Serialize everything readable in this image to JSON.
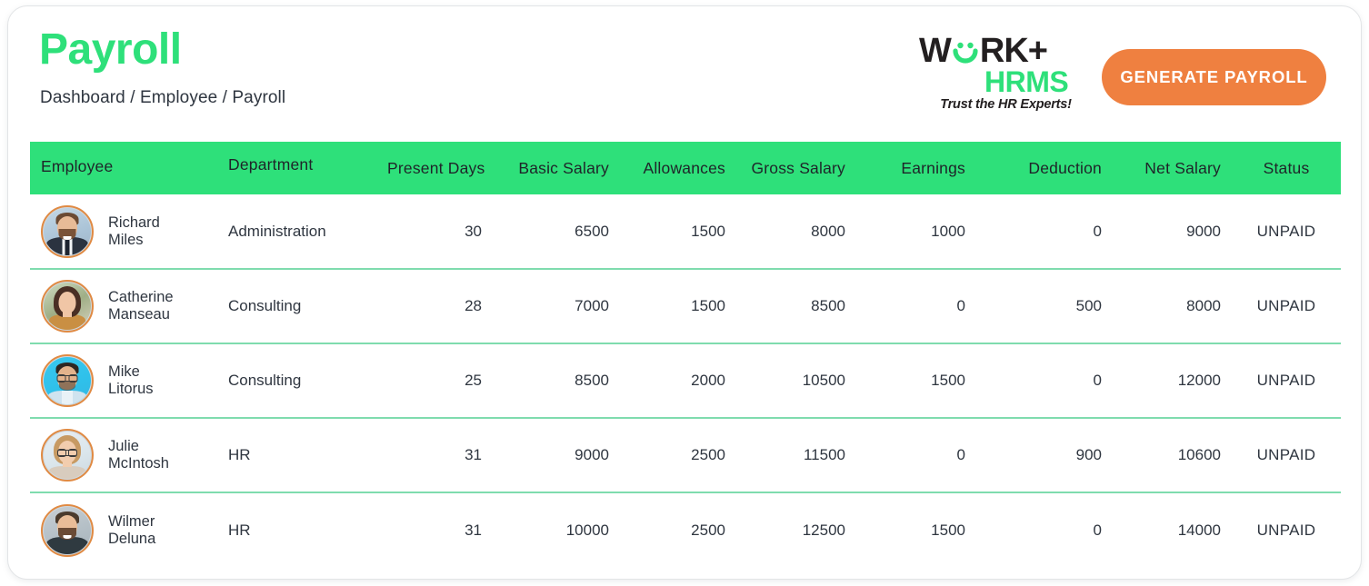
{
  "page": {
    "title": "Payroll",
    "breadcrumb": "Dashboard / Employee / Payroll"
  },
  "logo": {
    "word_left": "W",
    "word_right": "RK+",
    "sub": "HRMS",
    "tagline": "Trust the HR Experts!",
    "smiley_name": "smiley-face-o"
  },
  "actions": {
    "generate_payroll": "GENERATE PAYROLL"
  },
  "colors": {
    "brand_green": "#2ee07a",
    "header_green": "#2ee07a",
    "row_divider": "#7fdcae",
    "accent_orange": "#ef8040",
    "avatar_ring": "#e08a43",
    "text_dark": "#2f3640"
  },
  "table": {
    "columns": [
      "Employee",
      "Department",
      "Present Days",
      "Basic Salary",
      "Allowances",
      "Gross Salary",
      "Earnings",
      "Deduction",
      "Net Salary",
      "Status"
    ],
    "rows": [
      {
        "name": "Richard\nMiles",
        "department": "Administration",
        "present_days": "30",
        "basic_salary": "6500",
        "allowances": "1500",
        "gross_salary": "8000",
        "earnings": "1000",
        "deduction": "0",
        "net_salary": "9000",
        "status": "UNPAID"
      },
      {
        "name": "Catherine\nManseau",
        "department": "Consulting",
        "present_days": "28",
        "basic_salary": "7000",
        "allowances": "1500",
        "gross_salary": "8500",
        "earnings": "0",
        "deduction": "500",
        "net_salary": "8000",
        "status": "UNPAID"
      },
      {
        "name": "Mike\nLitorus",
        "department": "Consulting",
        "present_days": "25",
        "basic_salary": "8500",
        "allowances": "2000",
        "gross_salary": "10500",
        "earnings": "1500",
        "deduction": "0",
        "net_salary": "12000",
        "status": "UNPAID"
      },
      {
        "name": "Julie\nMcIntosh",
        "department": "HR",
        "present_days": "31",
        "basic_salary": "9000",
        "allowances": "2500",
        "gross_salary": "11500",
        "earnings": "0",
        "deduction": "900",
        "net_salary": "10600",
        "status": "UNPAID"
      },
      {
        "name": "Wilmer\nDeluna",
        "department": "HR",
        "present_days": "31",
        "basic_salary": "10000",
        "allowances": "2500",
        "gross_salary": "12500",
        "earnings": "1500",
        "deduction": "0",
        "net_salary": "14000",
        "status": "UNPAID"
      }
    ]
  }
}
